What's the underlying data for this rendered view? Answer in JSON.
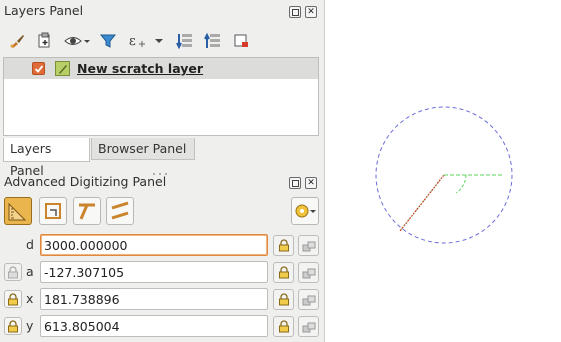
{
  "layers_panel": {
    "title": "Layers Panel",
    "toolbar_icons": [
      "paintbrush-icon",
      "add-group-icon",
      "eye-icon",
      "filter-icon",
      "expression-icon",
      "dropdown-icon",
      "expand-all-icon",
      "collapse-all-icon",
      "remove-layer-icon"
    ],
    "layers": [
      {
        "name": "New scratch layer",
        "checked": true
      }
    ]
  },
  "tabs": [
    {
      "label": "Layers Panel",
      "active": true
    },
    {
      "label": "Browser Panel",
      "active": false
    }
  ],
  "advanced_digitizing": {
    "title": "Advanced Digitizing Panel",
    "tool_icons": [
      "cad-enable-icon",
      "construction-mode-icon",
      "perpendicular-icon",
      "parallel-icon",
      "settings-gear-icon"
    ],
    "fields": [
      {
        "label": "d",
        "value": "3000.000000"
      },
      {
        "label": "a",
        "value": "-127.307105"
      },
      {
        "label": "x",
        "value": "181.738896"
      },
      {
        "label": "y",
        "value": "613.805004"
      }
    ]
  },
  "colors": {
    "accent_orange": "#e9b54c",
    "focus_border": "#e0883e",
    "circle_color": "#6d6ddc",
    "guide_green": "#5ed35e",
    "segment_red": "#d23c2c"
  }
}
